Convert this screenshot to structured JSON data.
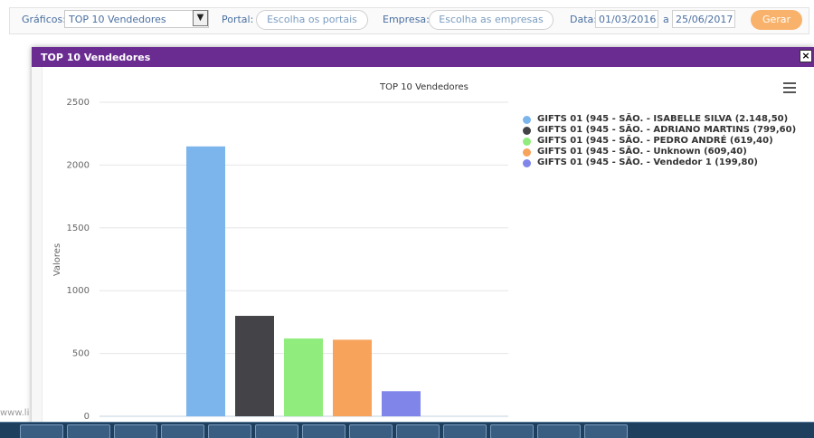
{
  "filters": {
    "graficos_label": "Gráficos:",
    "graficos_value": "TOP 10 Vendedores",
    "portal_label": "Portal:",
    "portal_placeholder": "Escolha os portais",
    "empresa_label": "Empresa:",
    "empresa_placeholder": "Escolha as empresas",
    "data_label": "Data:",
    "date_from": "01/03/2016",
    "date_sep": "a",
    "date_to": "25/06/2017",
    "submit_label": "Gerar"
  },
  "modal": {
    "title": "TOP 10 Vendedores",
    "close_label": "×"
  },
  "footer": {
    "text": "www.li"
  },
  "colors": {
    "header_purple": "#6a2c91",
    "button_orange": "#f9b26b"
  },
  "chart_data": {
    "type": "bar",
    "title": "TOP 10 Vendedores",
    "ylabel": "Valores",
    "ylim": [
      0,
      2500
    ],
    "yticks": [
      0,
      500,
      1000,
      1500,
      2000,
      2500
    ],
    "grid": true,
    "legend_position": "right",
    "series": [
      {
        "name": "GIFTS 01 (945 - SÃO. - ISABELLE SILVA (2.148,50)",
        "value": 2148.5,
        "color": "#7cb5ec"
      },
      {
        "name": "GIFTS 01 (945 - SÃO. - ADRIANO MARTINS (799,60)",
        "value": 799.6,
        "color": "#434348"
      },
      {
        "name": "GIFTS 01 (945 - SÃO. - PEDRO ANDRÉ (619,40)",
        "value": 619.4,
        "color": "#90ed7d"
      },
      {
        "name": "GIFTS 01 (945 - SÃO. - Unknown (609,40)",
        "value": 609.4,
        "color": "#f7a35c"
      },
      {
        "name": "GIFTS 01 (945 - SÃO. - Vendedor 1 (199,80)",
        "value": 199.8,
        "color": "#8085e9"
      }
    ]
  }
}
